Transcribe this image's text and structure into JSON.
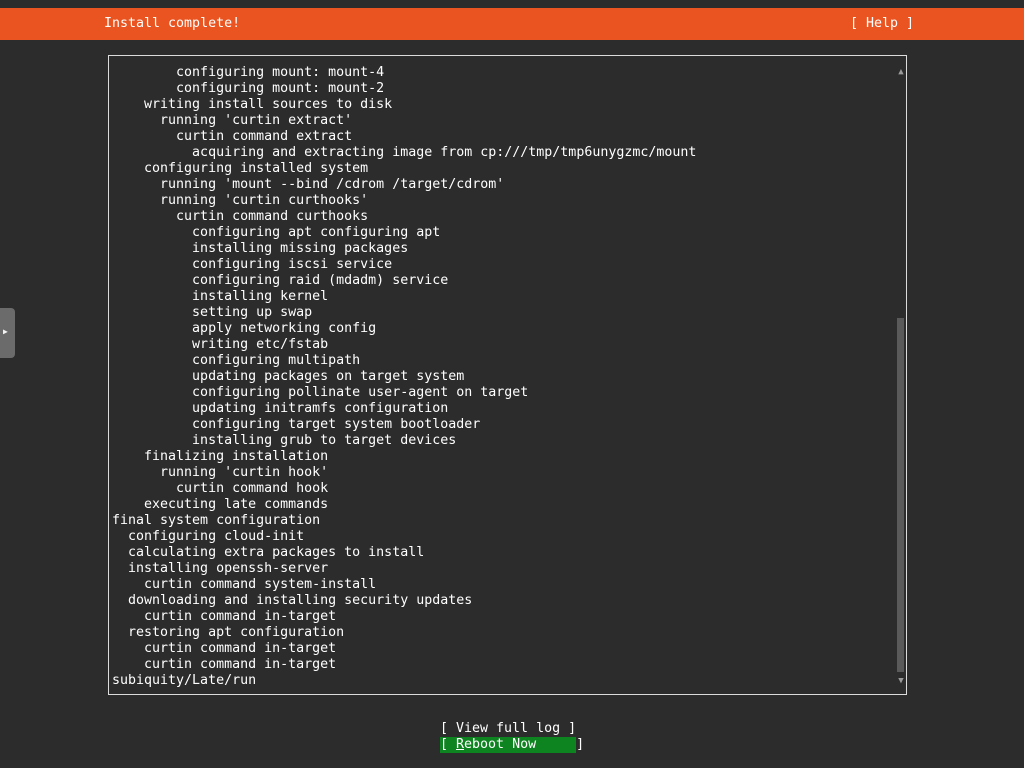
{
  "header": {
    "title": "Install complete!",
    "help_label": "[ Help ]",
    "background_color": "#e95420"
  },
  "log": {
    "lines": [
      "        configuring mount: mount-4",
      "        configuring mount: mount-2",
      "    writing install sources to disk",
      "      running 'curtin extract'",
      "        curtin command extract",
      "          acquiring and extracting image from cp:///tmp/tmp6unygzmc/mount",
      "    configuring installed system",
      "      running 'mount --bind /cdrom /target/cdrom'",
      "      running 'curtin curthooks'",
      "        curtin command curthooks",
      "          configuring apt configuring apt",
      "          installing missing packages",
      "          configuring iscsi service",
      "          configuring raid (mdadm) service",
      "          installing kernel",
      "          setting up swap",
      "          apply networking config",
      "          writing etc/fstab",
      "          configuring multipath",
      "          updating packages on target system",
      "          configuring pollinate user-agent on target",
      "          updating initramfs configuration",
      "          configuring target system bootloader",
      "          installing grub to target devices",
      "    finalizing installation",
      "      running 'curtin hook'",
      "        curtin command hook",
      "    executing late commands",
      "final system configuration",
      "  configuring cloud-init",
      "  calculating extra packages to install",
      "  installing openssh-server",
      "    curtin command system-install",
      "  downloading and installing security updates",
      "    curtin command in-target",
      "  restoring apt configuration",
      "    curtin command in-target",
      "    curtin command in-target",
      "subiquity/Late/run"
    ],
    "scroll_up_glyph": "▲",
    "scroll_down_glyph": "▼",
    "scroll_position_fraction": 0.4
  },
  "buttons": {
    "view_log": {
      "label": "[ View full log ]"
    },
    "reboot": {
      "prefix": "[ ",
      "accel": "R",
      "rest": "eboot Now     ]",
      "color": "#0e8420"
    }
  },
  "side_handle": {
    "icon_glyph": "▶"
  }
}
